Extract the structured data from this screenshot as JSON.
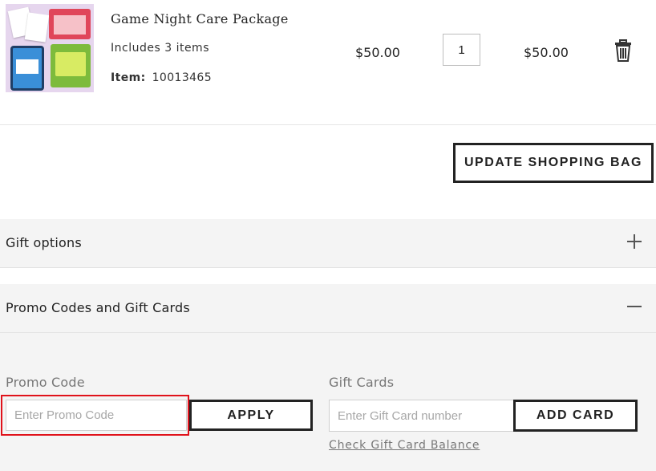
{
  "product": {
    "name": "Game Night Care Package",
    "includes": "Includes 3 items",
    "item_label": "Item:",
    "item_number": "10013465",
    "price": "$50.00",
    "quantity": "1",
    "subtotal": "$50.00",
    "image_icon": "product-thumbnail",
    "delete_icon": "trash-icon"
  },
  "cart": {
    "update_label": "UPDATE SHOPPING BAG"
  },
  "accordions": {
    "gift_options": {
      "title": "Gift options",
      "state": "collapsed",
      "icon": "plus-icon"
    },
    "promo": {
      "title": "Promo Codes and Gift Cards",
      "state": "expanded",
      "icon": "minus-icon"
    }
  },
  "promo_code": {
    "label": "Promo Code",
    "placeholder": "Enter Promo Code",
    "value": "",
    "apply_label": "APPLY"
  },
  "gift_cards": {
    "label": "Gift Cards",
    "placeholder": "Enter Gift Card number",
    "value": "",
    "add_label": "ADD CARD",
    "balance_link": "Check Gift Card Balance"
  },
  "colors": {
    "highlight": "#e0121b",
    "panel_bg": "#f4f4f4",
    "border_dark": "#222222"
  }
}
